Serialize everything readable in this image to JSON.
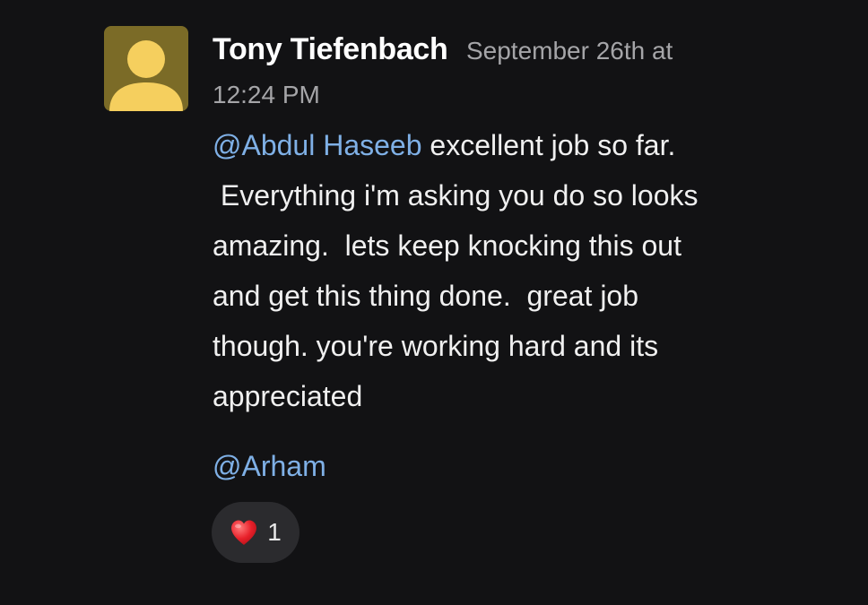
{
  "message": {
    "author": "Tony Tiefenbach",
    "timestamp_line1": "September 26th at",
    "timestamp_line2": "12:24 PM",
    "mention_primary": "@Abdul Haseeb",
    "body_line1_rest": " excellent job so far.",
    "body_lines": [
      " Everything i'm asking you do so looks",
      "amazing.  lets keep knocking this out",
      "and get this thing done.  great job",
      "though. you're working hard and its",
      "appreciated"
    ],
    "mention_secondary": "@Arham"
  },
  "reaction": {
    "icon": "heart-icon",
    "count": "1"
  },
  "colors": {
    "background": "#121214",
    "mention": "#7fb0e6",
    "timestamp": "#a5a5a8",
    "avatar_bg": "#7b6b27",
    "avatar_fg": "#f5cf5e",
    "reaction_bg": "#2b2b2e"
  }
}
